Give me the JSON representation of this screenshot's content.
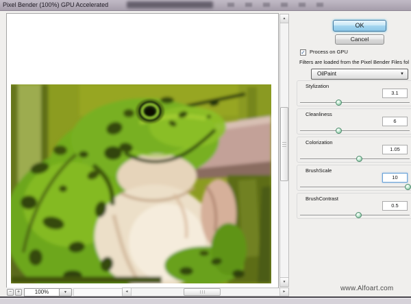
{
  "window": {
    "title": "Pixel Bender (100%) GPU Accelerated"
  },
  "dialog": {
    "ok_label": "OK",
    "cancel_label": "Cancel",
    "gpu_checkbox_label": "Process on GPU",
    "gpu_checkbox_checked": true,
    "filters_note": "Filters are loaded from the Pixel Bender Files fol",
    "filter_dropdown": {
      "selected": "OilPaint"
    },
    "parameters": [
      {
        "label": "Stylization",
        "value": "3.1",
        "percent": 35
      },
      {
        "label": "Cleanliness",
        "value": "6",
        "percent": 35
      },
      {
        "label": "Colorization",
        "value": "1.05",
        "percent": 54
      },
      {
        "label": "BrushScale",
        "value": "10",
        "percent": 98
      },
      {
        "label": "BrushContrast",
        "value": "0.5",
        "percent": 53
      }
    ]
  },
  "preview": {
    "zoom_value": "100%",
    "watermark": "www.Alfoart.com",
    "subject": "oil-paint stylized green frog on olive background"
  },
  "icons": {
    "dropdown_arrow": "▼",
    "scroll_up": "▲",
    "scroll_down": "▼",
    "scroll_left": "◄",
    "scroll_right": "►",
    "zoom_out": "−",
    "zoom_in": "+",
    "checkmark": "✓"
  },
  "colors": {
    "titlebar": "#aba3b0",
    "dialog_bg": "#f0efed",
    "ok_button_blue": "#9fd4ef",
    "slider_thumb_green": "#7cb896",
    "frog_green": "#74ac20",
    "frog_dark_spot": "#35490c",
    "frog_belly": "#ecdfc8",
    "board_pink": "#c3a198",
    "background_olive": "#8c9c20"
  }
}
